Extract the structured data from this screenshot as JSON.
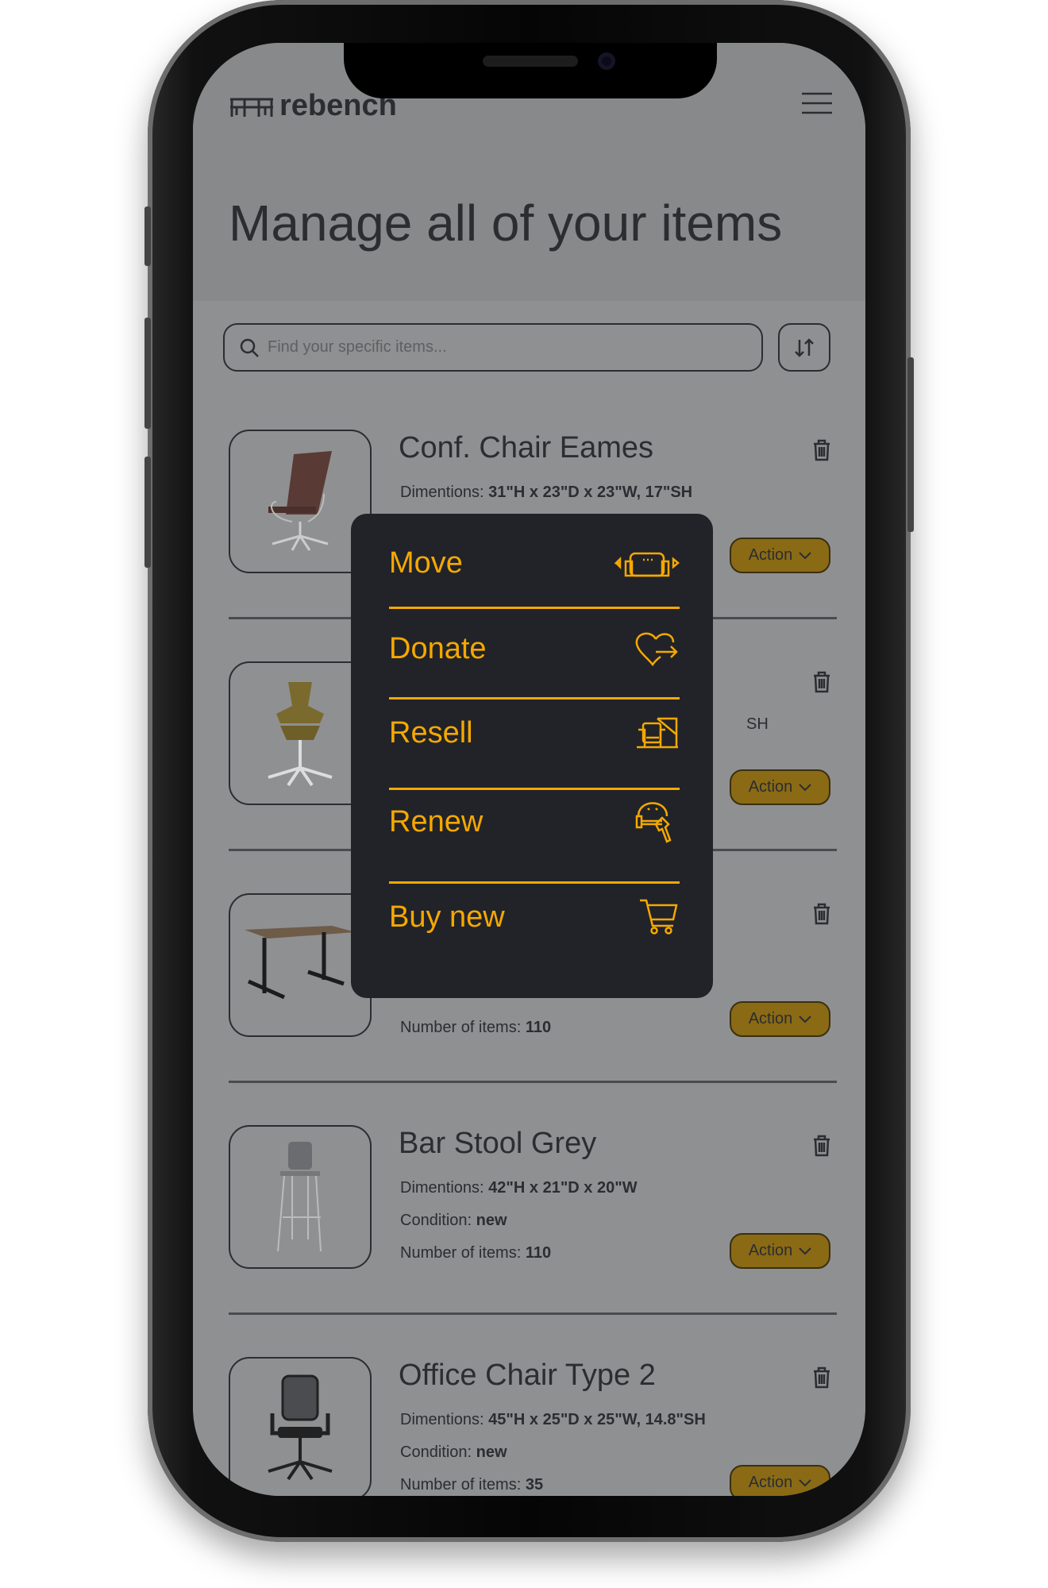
{
  "app": {
    "logo_text": "rebench",
    "menu_icon": "hamburger-icon"
  },
  "page": {
    "title": "Manage all of your items"
  },
  "search": {
    "placeholder": "Find your specific items...",
    "value": ""
  },
  "colors": {
    "accent": "#f5a800",
    "menu_bg": "#212329",
    "action_bg": "#8a6a14",
    "overlay": "#8f9092"
  },
  "items": [
    {
      "title": "Conf. Chair Eames",
      "dim_label": "Dimentions:",
      "dim_value": "31\"H x 23\"D x 23\"W, 17\"SH",
      "action": "Action"
    },
    {
      "dims_visible": "SH",
      "action": "Action"
    },
    {
      "count_label": "Number of items:",
      "count_value": "110",
      "action": "Action"
    },
    {
      "title": "Bar Stool Grey",
      "dim_label": "Dimentions:",
      "dim_value": "42\"H x 21\"D x 20\"W",
      "cond_label": "Condition:",
      "cond_value": "new",
      "count_label": "Number of items:",
      "count_value": "110",
      "action": "Action"
    },
    {
      "title": "Office Chair Type 2",
      "dim_label": "Dimentions:",
      "dim_value": "45\"H x 25\"D x 25\"W, 14.8\"SH",
      "cond_label": "Condition:",
      "cond_value": "new",
      "count_label": "Number of items:",
      "count_value": "35",
      "action": "Action"
    }
  ],
  "action_menu": {
    "items": [
      {
        "label": "Move",
        "icon": "move-sofa-icon"
      },
      {
        "label": "Donate",
        "icon": "heart-arrow-icon"
      },
      {
        "label": "Resell",
        "icon": "resell-chair-icon"
      },
      {
        "label": "Renew",
        "icon": "repair-wrench-icon"
      },
      {
        "label": "Buy new",
        "icon": "cart-icon"
      }
    ]
  }
}
